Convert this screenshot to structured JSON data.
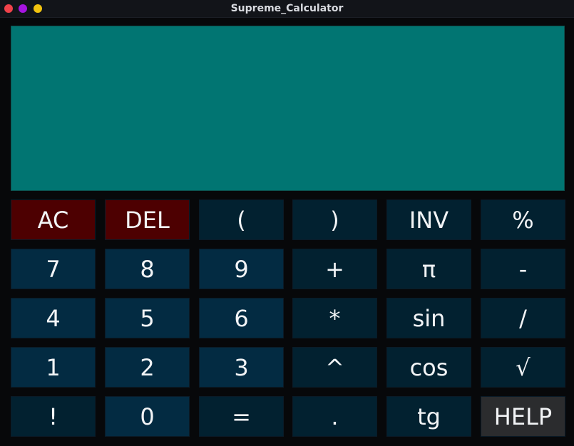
{
  "window": {
    "title": "Supreme_Calculator",
    "traffic_lights": [
      {
        "name": "close",
        "color": "#f0424a"
      },
      {
        "name": "minimize",
        "color": "#a614e0"
      },
      {
        "name": "maximize",
        "color": "#f2c30f"
      }
    ]
  },
  "colors": {
    "display_bg": "#017572",
    "key_default": "#022130",
    "key_number": "#032b42",
    "key_danger": "#4d0001",
    "key_help": "#2b2c2e"
  },
  "display": {
    "value": ""
  },
  "keys": [
    {
      "label": "AC",
      "style": "danger"
    },
    {
      "label": "DEL",
      "style": "danger"
    },
    {
      "label": "(",
      "style": "default"
    },
    {
      "label": ")",
      "style": "default"
    },
    {
      "label": "INV",
      "style": "default"
    },
    {
      "label": "%",
      "style": "default"
    },
    {
      "label": "7",
      "style": "number"
    },
    {
      "label": "8",
      "style": "number"
    },
    {
      "label": "9",
      "style": "number"
    },
    {
      "label": "+",
      "style": "default"
    },
    {
      "label": "π",
      "style": "default"
    },
    {
      "label": "-",
      "style": "default"
    },
    {
      "label": "4",
      "style": "number"
    },
    {
      "label": "5",
      "style": "number"
    },
    {
      "label": "6",
      "style": "number"
    },
    {
      "label": "*",
      "style": "default"
    },
    {
      "label": "sin",
      "style": "default"
    },
    {
      "label": "/",
      "style": "default"
    },
    {
      "label": "1",
      "style": "number"
    },
    {
      "label": "2",
      "style": "number"
    },
    {
      "label": "3",
      "style": "number"
    },
    {
      "label": "^",
      "style": "default"
    },
    {
      "label": "cos",
      "style": "default"
    },
    {
      "label": "√",
      "style": "default"
    },
    {
      "label": "!",
      "style": "default"
    },
    {
      "label": "0",
      "style": "number"
    },
    {
      "label": "=",
      "style": "default"
    },
    {
      "label": ".",
      "style": "default"
    },
    {
      "label": "tg",
      "style": "default"
    },
    {
      "label": "HELP",
      "style": "help"
    }
  ]
}
